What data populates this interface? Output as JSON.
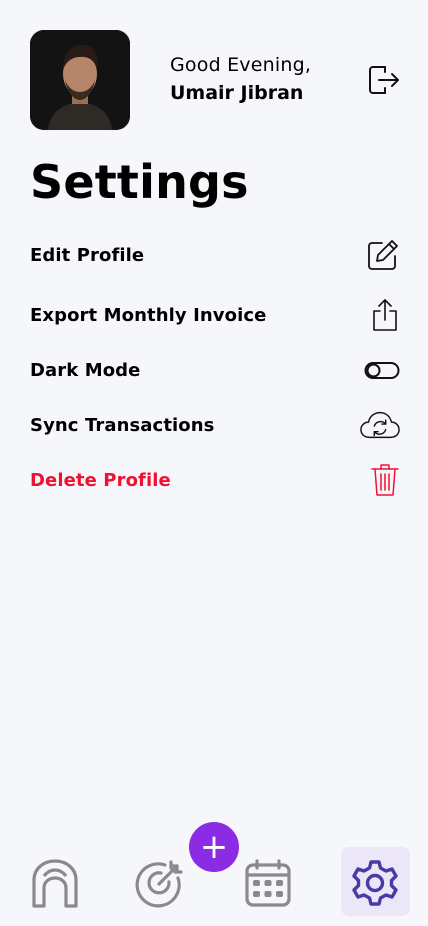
{
  "header": {
    "greeting": "Good Evening,",
    "user_name": "Umair Jibran"
  },
  "page": {
    "title": "Settings"
  },
  "settings": [
    {
      "label": "Edit Profile",
      "icon": "edit-icon"
    },
    {
      "label": "Export Monthly Invoice",
      "icon": "share-export-icon"
    },
    {
      "label": "Dark Mode",
      "icon": "toggle-off-icon",
      "toggle_on": false
    },
    {
      "label": "Sync Transactions",
      "icon": "cloud-sync-icon"
    },
    {
      "label": "Delete Profile",
      "icon": "trash-icon",
      "color": "#ee1133"
    }
  ],
  "fab": {
    "label": "+",
    "color": "#8b2be3"
  },
  "bottom_nav": {
    "items": [
      "home-icon",
      "target-icon",
      "calendar-icon",
      "settings-gear-icon"
    ],
    "active": "settings-gear-icon",
    "active_color": "#4a3aa8"
  }
}
